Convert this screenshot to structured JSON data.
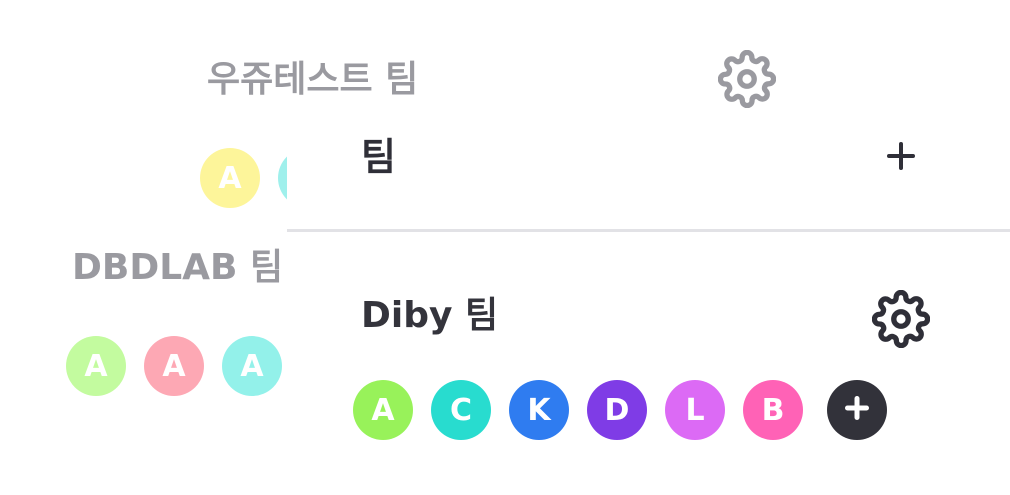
{
  "background_teams": [
    {
      "name": "우쥬테스트 팀",
      "members": [
        {
          "initial": "A",
          "color": "#fdf59a"
        },
        {
          "initial": "",
          "color": "#9ff0ec"
        }
      ]
    },
    {
      "name": "DBDLAB 팀",
      "members": [
        {
          "initial": "A",
          "color": "#c3fb9f"
        },
        {
          "initial": "A",
          "color": "#fda8b4"
        },
        {
          "initial": "A",
          "color": "#93f1ea"
        }
      ]
    }
  ],
  "panel": {
    "title": "팀",
    "add_icon": "plus-icon",
    "team": {
      "name": "Diby 팀",
      "settings_icon": "gear-icon",
      "members": [
        {
          "initial": "A",
          "color": "#98f25a"
        },
        {
          "initial": "C",
          "color": "#28dccf"
        },
        {
          "initial": "K",
          "color": "#2f7cf0"
        },
        {
          "initial": "D",
          "color": "#7f3ce6"
        },
        {
          "initial": "L",
          "color": "#dc6af5"
        },
        {
          "initial": "B",
          "color": "#ff62b6"
        }
      ],
      "add_member_icon": "plus-icon"
    }
  },
  "colors": {
    "text_dark": "#2f2f38",
    "text_faded": "#9a9aa0",
    "divider": "#e2e2e6",
    "add_member_bg": "#32323a"
  }
}
